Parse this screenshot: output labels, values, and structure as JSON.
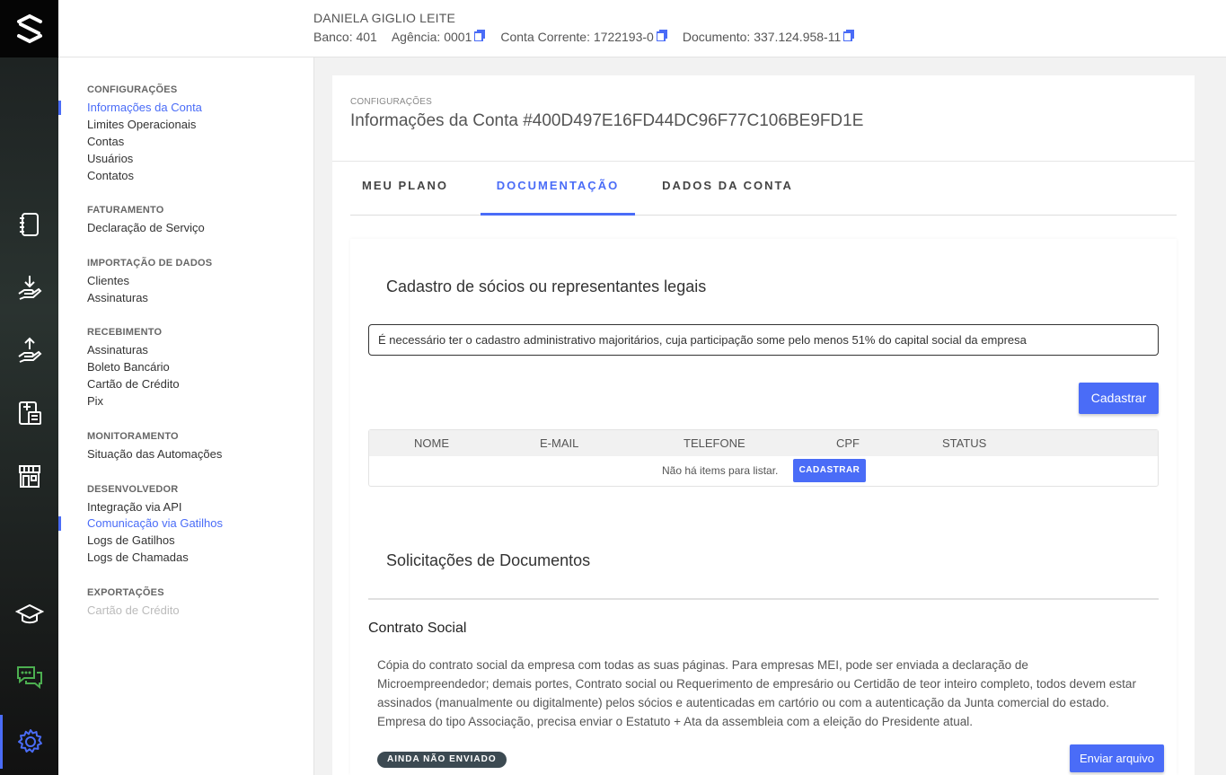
{
  "colors": {
    "accent": "#4a6cf7",
    "rail_bg": "#1b1f1f",
    "chat_icon": "#4caf50"
  },
  "rail": {
    "icons": [
      "brand-logo-icon",
      "notebook-icon",
      "hand-receive-icon",
      "hand-send-icon",
      "calculator-sheet-icon",
      "storefront-icon",
      "graduation-cap-icon",
      "chat-bubbles-icon",
      "gear-icon"
    ]
  },
  "header": {
    "account_name": "DANIELA GIGLIO LEITE",
    "banco_label": "Banco:",
    "banco": "401",
    "agencia_label": "Agência:",
    "agencia": "0001",
    "conta_label": "Conta Corrente:",
    "conta": "1722193-0",
    "documento_label": "Documento:",
    "documento": "337.124.958-11"
  },
  "sidebar": {
    "groups": [
      {
        "title": "CONFIGURAÇÕES",
        "items": [
          "Informações da Conta",
          "Limites Operacionais",
          "Contas",
          "Usuários",
          "Contatos"
        ]
      },
      {
        "title": "FATURAMENTO",
        "items": [
          "Declaração de Serviço"
        ]
      },
      {
        "title": "IMPORTAÇÃO DE DADOS",
        "items": [
          "Clientes",
          "Assinaturas"
        ]
      },
      {
        "title": "RECEBIMENTO",
        "items": [
          "Assinaturas",
          "Boleto Bancário",
          "Cartão de Crédito",
          "Pix"
        ]
      },
      {
        "title": "MONITORAMENTO",
        "items": [
          "Situação das Automações"
        ]
      },
      {
        "title": "DESENVOLVEDOR",
        "items": [
          "Integração via API",
          "Comunicação via Gatilhos",
          "Logs de Gatilhos",
          "Logs de Chamadas"
        ]
      },
      {
        "title": "EXPORTAÇÕES",
        "items": [
          "Cartão de Crédito"
        ]
      }
    ]
  },
  "main": {
    "breadcrumb": "CONFIGURAÇÕES",
    "title": "Informações da Conta #400D497E16FD44DC96F77C106BE9FD1E",
    "tabs": [
      "MEU PLANO",
      "DOCUMENTAÇÃO",
      "DADOS DA CONTA"
    ],
    "active_tab": "DOCUMENTAÇÃO",
    "partners": {
      "title": "Cadastro de sócios ou representantes legais",
      "alert": "É necessário ter o cadastro administrativo majoritários, cuja participação some pelo menos 51% do capital social da empresa",
      "add_button": "Cadastrar",
      "columns": [
        "NOME",
        "E-MAIL",
        "TELEFONE",
        "CPF",
        "STATUS"
      ],
      "empty_text": "Não há items para listar.",
      "empty_button": "CADASTRAR"
    },
    "requests": {
      "title": "Solicitações de Documentos",
      "doc_title": "Contrato Social",
      "doc_description": "Cópia do contrato social da empresa com todas as suas páginas. Para empresas MEI, pode ser enviada a declaração de Microempreendedor; demais portes, Contrato social ou Requerimento de empresário ou Certidão de teor inteiro completo, todos devem estar assinados (manualmente ou digitalmente) pelos sócios e autenticadas em cartório ou com a autenticação da Junta comercial do estado. Empresa do tipo Associação, precisa enviar o Estatuto + Ata da assembleia com a eleição do Presidente atual.",
      "status_badge": "AINDA NÃO ENVIADO",
      "upload_button": "Enviar arquivo"
    }
  }
}
